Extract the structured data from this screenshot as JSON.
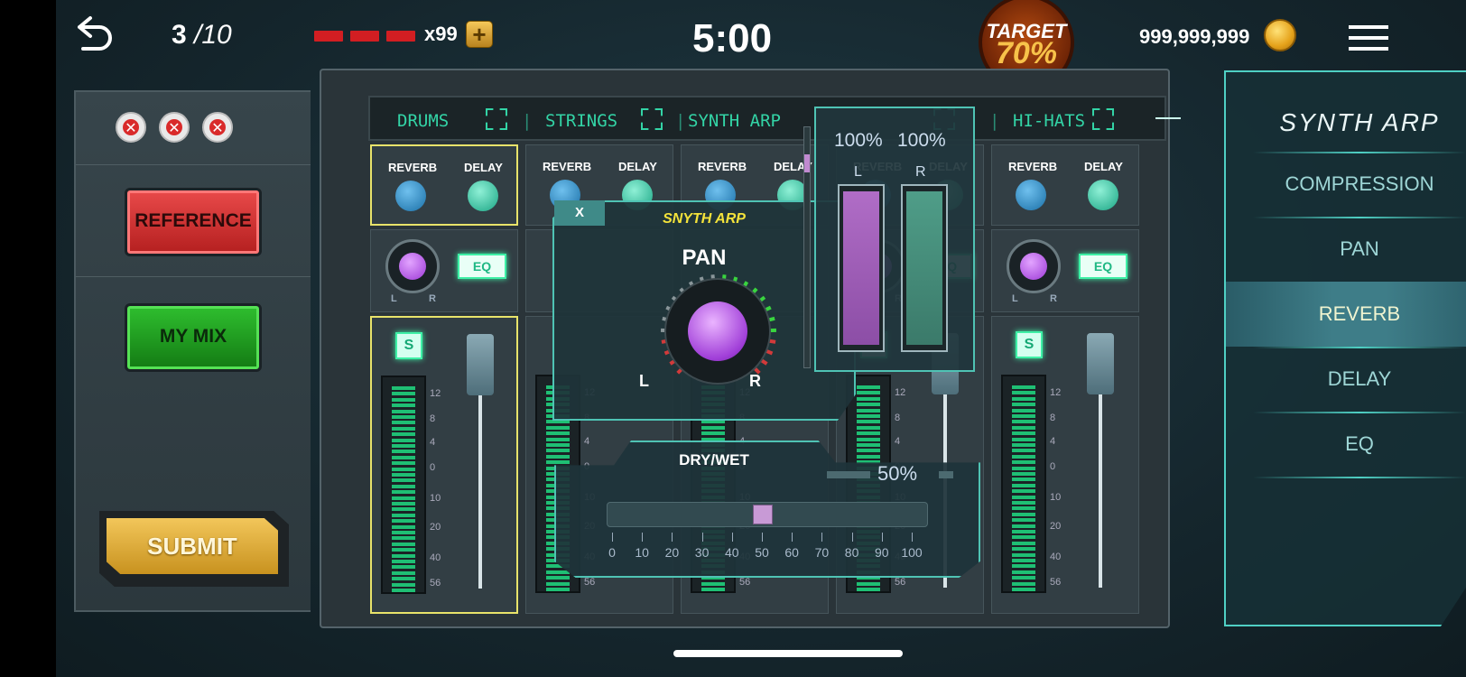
{
  "topbar": {
    "progress_current": "3",
    "progress_total": "/10",
    "lives_count": "x99",
    "timer": "5:00",
    "target_label": "TARGET",
    "target_value": "70%",
    "coins": "999,999,999"
  },
  "left_panel": {
    "reference_label": "REFERENCE",
    "my_mix_label": "MY MIX",
    "submit_label": "SUBMIT"
  },
  "tabs": [
    "DRUMS",
    "STRINGS",
    "SYNTH ARP",
    "HI-HATS"
  ],
  "channel": {
    "reverb_label": "REVERB",
    "delay_label": "DELAY",
    "eq_label": "EQ",
    "solo_label": "S",
    "pan_l": "L",
    "pan_r": "R",
    "scale": [
      "12",
      "8",
      "4",
      "0",
      "10",
      "20",
      "40",
      "56"
    ]
  },
  "pan_popup": {
    "title": "SNYTH ARP",
    "label": "PAN",
    "l": "L",
    "r": "R",
    "close": "X"
  },
  "volume_popup": {
    "left_value": "100%",
    "right_value": "100%",
    "l": "L",
    "r": "R",
    "left_level": 1.0,
    "right_level": 1.0
  },
  "dry_wet": {
    "label": "DRY/WET",
    "value": "50%",
    "ticks": [
      "0",
      "10",
      "20",
      "30",
      "40",
      "50",
      "60",
      "70",
      "80",
      "90",
      "100"
    ]
  },
  "right_panel": {
    "title": "SYNTH ARP",
    "items": [
      "COMPRESSION",
      "PAN",
      "REVERB",
      "DELAY",
      "EQ"
    ],
    "active": "REVERB"
  },
  "colors": {
    "accent": "#33d4a6",
    "panel_border": "#4fd0c4",
    "target": "#f7c24a",
    "popup_title": "#f4e33a"
  }
}
